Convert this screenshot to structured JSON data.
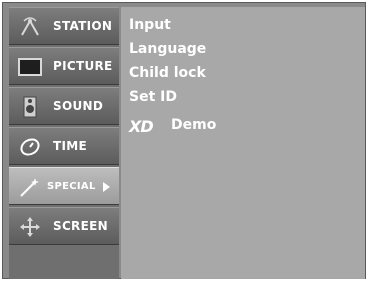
{
  "sidebar": {
    "items": [
      {
        "label": "STATION",
        "icon": "antenna-icon"
      },
      {
        "label": "PICTURE",
        "icon": "tv-icon"
      },
      {
        "label": "SOUND",
        "icon": "speaker-icon"
      },
      {
        "label": "TIME",
        "icon": "clock-icon"
      },
      {
        "label": "SPECIAL",
        "icon": "wand-icon",
        "active": true
      },
      {
        "label": "SCREEN",
        "icon": "move-icon"
      }
    ]
  },
  "content": {
    "options": [
      {
        "label": "Input"
      },
      {
        "label": "Language"
      },
      {
        "label": "Child lock"
      },
      {
        "label": "Set ID"
      }
    ],
    "xd": {
      "logo": "XD",
      "label": "Demo"
    }
  },
  "colors": {
    "panel": "#8a8a8a",
    "sidebar": "#6f6f6f",
    "active_item": "#bdbdbd",
    "content": "#a8a8a8",
    "text": "#ffffff"
  }
}
